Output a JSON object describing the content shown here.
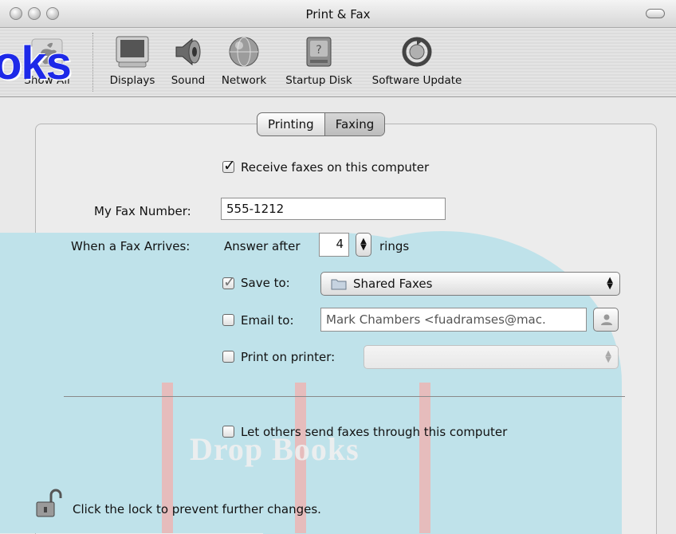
{
  "window": {
    "title": "Print & Fax"
  },
  "watermark_text": "oks",
  "watermark_logo": "Drop Books",
  "toolbar": {
    "show_all": "Show All",
    "items": [
      {
        "label": "Displays",
        "icon": "display-icon"
      },
      {
        "label": "Sound",
        "icon": "speaker-icon"
      },
      {
        "label": "Network",
        "icon": "globe-icon"
      },
      {
        "label": "Startup Disk",
        "icon": "disk-icon"
      },
      {
        "label": "Software Update",
        "icon": "update-icon"
      }
    ]
  },
  "tabs": [
    {
      "label": "Printing",
      "selected": false
    },
    {
      "label": "Faxing",
      "selected": true
    }
  ],
  "fax": {
    "receive_label": "Receive faxes on this computer",
    "receive_checked": true,
    "number_label": "My Fax Number:",
    "number_value": "555-1212",
    "arrives_label": "When a Fax Arrives:",
    "answer_after": "Answer after",
    "rings_value": "4",
    "rings_label": "rings",
    "save_to_label": "Save to:",
    "save_to_value": "Shared Faxes",
    "email_label": "Email to:",
    "email_value": "Mark Chambers <fuadramses@mac.",
    "print_label": "Print on printer:",
    "print_value": "",
    "share_label": "Let others send faxes through this computer"
  },
  "lock": {
    "text": "Click the lock to prevent further changes."
  }
}
